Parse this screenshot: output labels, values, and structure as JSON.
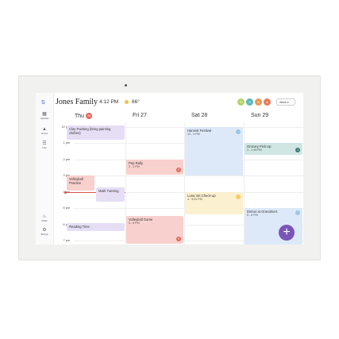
{
  "header": {
    "family_name": "Jones Family",
    "time": "4:12 PM",
    "temperature": "66°",
    "avatars": [
      {
        "initial": "V",
        "color": "#b7d36a"
      },
      {
        "initial": "S",
        "color": "#58b8b8"
      },
      {
        "initial": "S",
        "color": "#e59a57"
      },
      {
        "initial": "A",
        "color": "#e57a58"
      }
    ],
    "view_select": "Week"
  },
  "sidebar": {
    "logo": "S",
    "items": [
      {
        "label": "Calendar",
        "icon": "calendar-icon"
      },
      {
        "label": "Chores",
        "icon": "chores-icon"
      },
      {
        "label": "Lists",
        "icon": "lists-icon"
      },
      {
        "label": "Meals",
        "icon": "meals-icon"
      },
      {
        "label": "Settings",
        "icon": "settings-icon"
      }
    ]
  },
  "days": [
    {
      "label": "Thu",
      "badge": "26"
    },
    {
      "label": "Fri 27"
    },
    {
      "label": "Sat 28"
    },
    {
      "label": "Sun 29"
    }
  ],
  "hours": [
    "12 pm",
    "1 pm",
    "2 pm",
    "3 pm",
    "4 pm",
    "5 pm",
    "6 pm",
    "7 pm"
  ],
  "events": [
    {
      "title": "Clay Painting (bring painting clothes)",
      "sub": "",
      "color": "#e6def5"
    },
    {
      "title": "Volleyball Practice",
      "sub": "",
      "color": "#f8d0cd"
    },
    {
      "title": "Math Tutoring",
      "sub": "",
      "color": "#e6def5"
    },
    {
      "title": "Reading Time",
      "sub": "",
      "color": "#e6def5"
    },
    {
      "title": "Pep Rally",
      "sub": "2 - 3 PM",
      "color": "#f8d0cd",
      "badge": "E",
      "badge_color": "#e2685a"
    },
    {
      "title": "Volleyball Game",
      "sub": "5 - 6 PM",
      "color": "#f8d0cd",
      "badge": "E",
      "badge_color": "#e2685a"
    },
    {
      "title": "Harvest Festival",
      "sub": "12 - 3 PM",
      "color": "#dde9f8",
      "badge": "",
      "badge_color": "#9cc6e8"
    },
    {
      "title": "Luna Vet Check-up",
      "sub": "4 - 5:30 PM",
      "color": "#fbf0cf",
      "badge": "",
      "badge_color": "#f1cd6a"
    },
    {
      "title": "Grocery Pick Up",
      "sub": "1 - 1:45 PM",
      "color": "#cfe6e3",
      "badge": "J",
      "badge_color": "#3e7b74"
    },
    {
      "title": "Dinner at Grandma's",
      "sub": "5 - 8 PM",
      "color": "#dde9f8",
      "badge": "",
      "badge_color": "#9cc6e8"
    }
  ],
  "fab": "+"
}
